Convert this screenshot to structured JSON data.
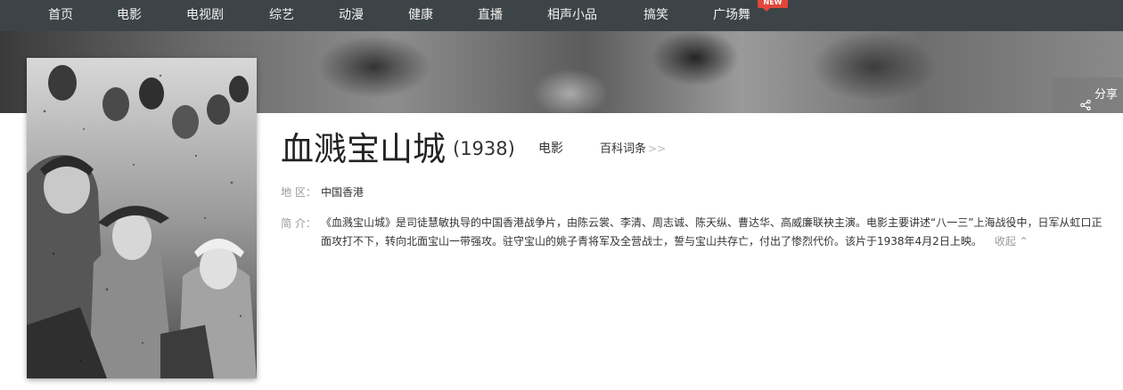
{
  "nav": {
    "items": [
      {
        "label": "首页"
      },
      {
        "label": "电影"
      },
      {
        "label": "电视剧"
      },
      {
        "label": "综艺"
      },
      {
        "label": "动漫"
      },
      {
        "label": "健康"
      },
      {
        "label": "直播"
      },
      {
        "label": "相声小品"
      },
      {
        "label": "搞笑"
      },
      {
        "label": "广场舞"
      }
    ],
    "new_badge": "NEW"
  },
  "share": {
    "label": "分享",
    "icon": "share-icon"
  },
  "movie": {
    "title": "血溅宝山城",
    "year": "(1938)",
    "category": "电影",
    "baike_link": "百科词条",
    "region_label": "地 区：",
    "region": "中国香港",
    "intro_label": "简 介：",
    "intro": "《血溅宝山城》是司徒慧敏执导的中国香港战争片，由陈云裳、李清、周志诚、陈天纵、曹达华、高威廉联袂主演。电影主要讲述“八一三”上海战役中，日军从虹口正面攻打不下，转向北面宝山一带强攻。驻守宝山的姚子青将军及全营战士，誓与宝山共存亡，付出了惨烈代价。该片于1938年4月2日上映。",
    "collapse_label": "收起"
  },
  "colors": {
    "nav_bg": "#3d4447",
    "badge": "#e2463a"
  }
}
